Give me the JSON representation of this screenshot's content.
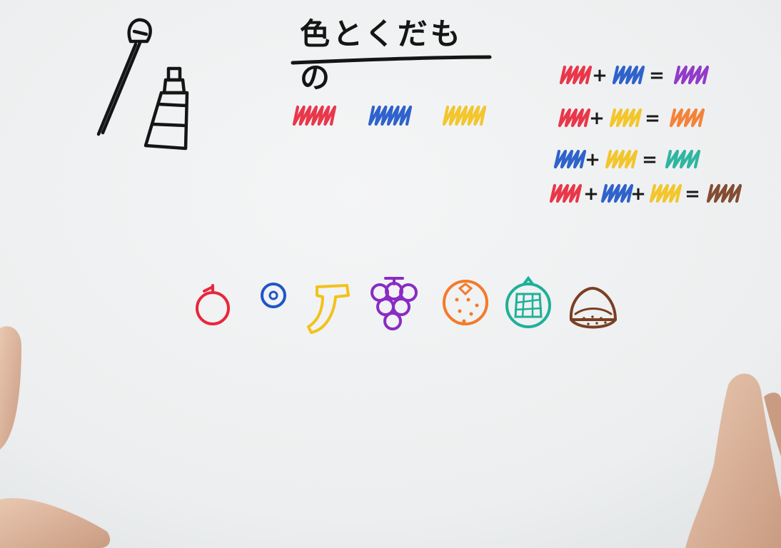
{
  "title": "色とくだもの",
  "colors": {
    "red": "#e8273c",
    "blue": "#1e56c8",
    "yellow": "#f2c21b",
    "purple": "#8a2bc4",
    "orange": "#f47a2a",
    "green": "#1fb09a",
    "brown": "#7a3f22",
    "ink": "#151515"
  },
  "primary_swatches": [
    "red",
    "blue",
    "yellow"
  ],
  "equations": [
    {
      "terms": [
        "red",
        "blue"
      ],
      "result": "purple"
    },
    {
      "terms": [
        "red",
        "yellow"
      ],
      "result": "orange"
    },
    {
      "terms": [
        "blue",
        "yellow"
      ],
      "result": "green"
    },
    {
      "terms": [
        "red",
        "blue",
        "yellow"
      ],
      "result": "brown"
    }
  ],
  "operators": {
    "plus": "+",
    "equals": "="
  },
  "fruits": [
    {
      "name": "apple-icon",
      "color": "red"
    },
    {
      "name": "blueberry-icon",
      "color": "blue"
    },
    {
      "name": "banana-icon",
      "color": "yellow"
    },
    {
      "name": "grapes-icon",
      "color": "purple"
    },
    {
      "name": "orange-fruit-icon",
      "color": "orange"
    },
    {
      "name": "melon-icon",
      "color": "green"
    },
    {
      "name": "chestnut-icon",
      "color": "brown"
    }
  ],
  "tools": [
    "paintbrush-icon",
    "paint-tube-icon"
  ]
}
